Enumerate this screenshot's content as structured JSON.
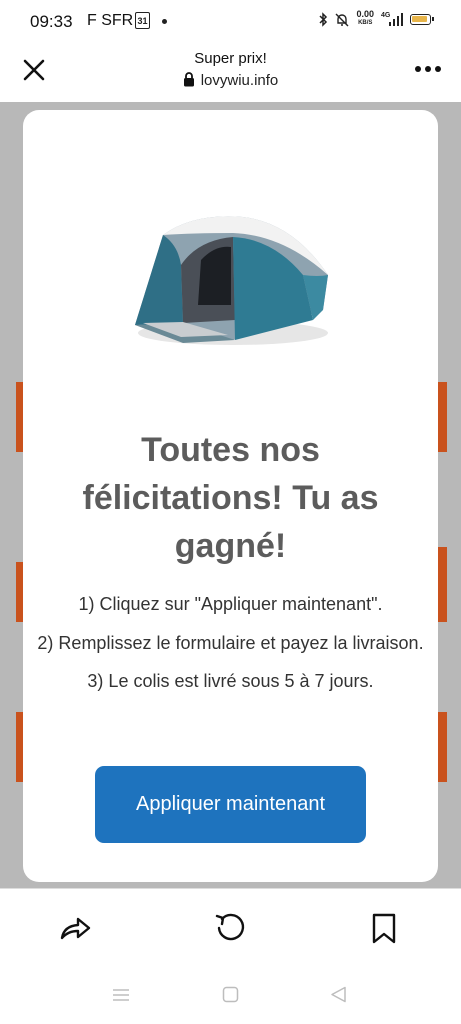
{
  "status_bar": {
    "time": "09:33",
    "carrier": "F SFR",
    "calendar_day": "31",
    "network_speed_value": "0.00",
    "network_speed_unit": "KB/S",
    "network_type": "4G"
  },
  "browser": {
    "title": "Super prix!",
    "url": "lovywiu.info"
  },
  "modal": {
    "headline": "Toutes nos félicitations! Tu as gagné!",
    "steps": [
      "1) Cliquez sur \"Appliquer maintenant\".",
      "2) Remplissez le formulaire et payez la livraison.",
      "3) Le colis est livré sous 5 à 7 jours."
    ],
    "cta_label": "Appliquer maintenant",
    "cta_color": "#1e73be",
    "headline_color": "#5c5c5c"
  },
  "icons": {
    "close": "close-icon",
    "lock": "lock-icon",
    "more": "more-vertical-dots-icon",
    "share": "share-icon",
    "reload": "reload-icon",
    "bookmark": "bookmark-icon"
  }
}
